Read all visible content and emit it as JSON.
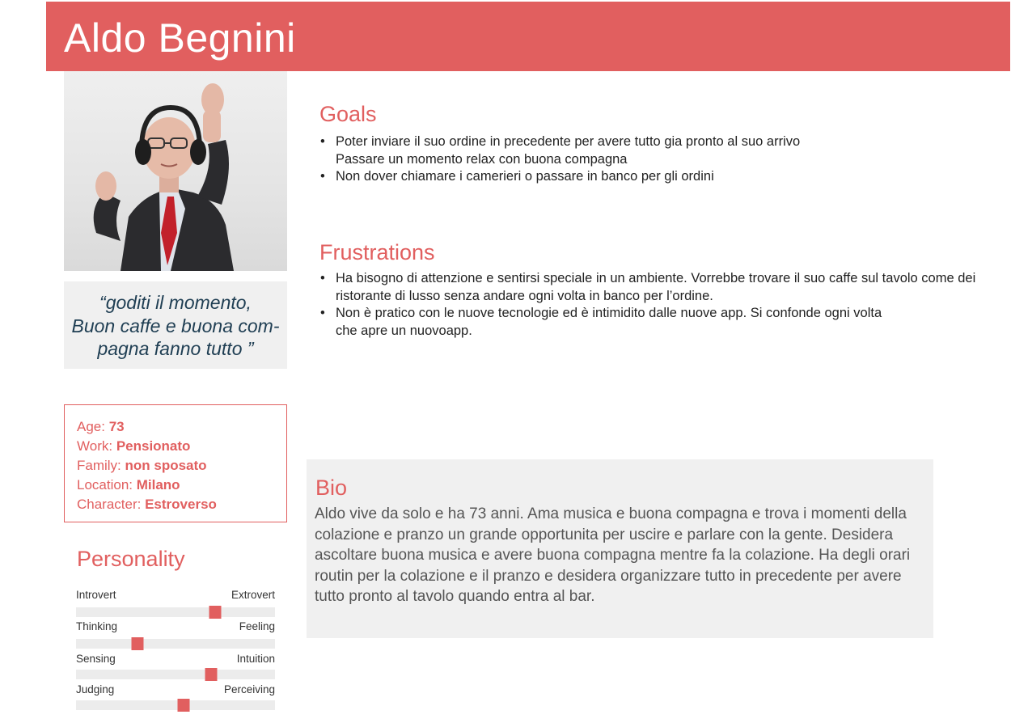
{
  "persona": {
    "name": "Aldo Begnini",
    "photo_alt": "photo",
    "quote": {
      "line1": "“goditi il momento,",
      "line2": "Buon caffe e buona com-",
      "line3": "pagna fanno tutto ”"
    }
  },
  "info": {
    "age_label": "Age: ",
    "age_value": "73",
    "work_label": "Work: ",
    "work_value": "Pensionato",
    "family_label": "Family: ",
    "family_value": "non sposato",
    "location_label": "Location: ",
    "location_value": "Milano",
    "character_label": "Character: ",
    "character_value": "Estroverso"
  },
  "personality": {
    "title": "Personality",
    "traits": [
      {
        "left": "Introvert",
        "right": "Extrovert",
        "level": 0.7
      },
      {
        "left": "Thinking",
        "right": "Feeling",
        "level": 0.31
      },
      {
        "left": "Sensing",
        "right": "Intuition",
        "level": 0.68
      },
      {
        "left": "Judging",
        "right": "Perceiving",
        "level": 0.54
      }
    ]
  },
  "goals": {
    "title": "Goals",
    "items": [
      "Poter inviare il suo ordine in precedente per avere tutto gia pronto al suo arrivo",
      "Passare un momento relax con buona compagna",
      "Non dover chiamare i camerieri o passare in banco per gli ordini"
    ]
  },
  "frustrations": {
    "title": "Frustrations",
    "items": [
      "Ha bisogno di attenzione e sentirsi speciale in un ambiente. Vorrebbe trovare il suo caffe sul tavolo come dei ristorante di lusso senza andare ogni volta in banco per l’ordine.",
      "Non è pratico con le nuove tecnologie ed è intimidito dalle nuove app. Si confonde ogni volta che apre un nuovoapp."
    ]
  },
  "bio": {
    "title": "Bio",
    "text": "Aldo vive da solo e ha 73 anni. Ama musica e buona compagna e trova i momenti della colazione e pranzo un grande opportunita per uscire e parlare con la gente. Desidera ascoltare buona musica e avere buona compagna mentre fa la colazione. Ha degli orari routin per la colazione e il pranzo e desidera organizzare tutto in precedente per avere tutto pronto al tavolo quando entra al bar."
  },
  "colors": {
    "accent": "#e15f5f",
    "panel": "#f0f0f0",
    "quote_text": "#1f3e53"
  }
}
